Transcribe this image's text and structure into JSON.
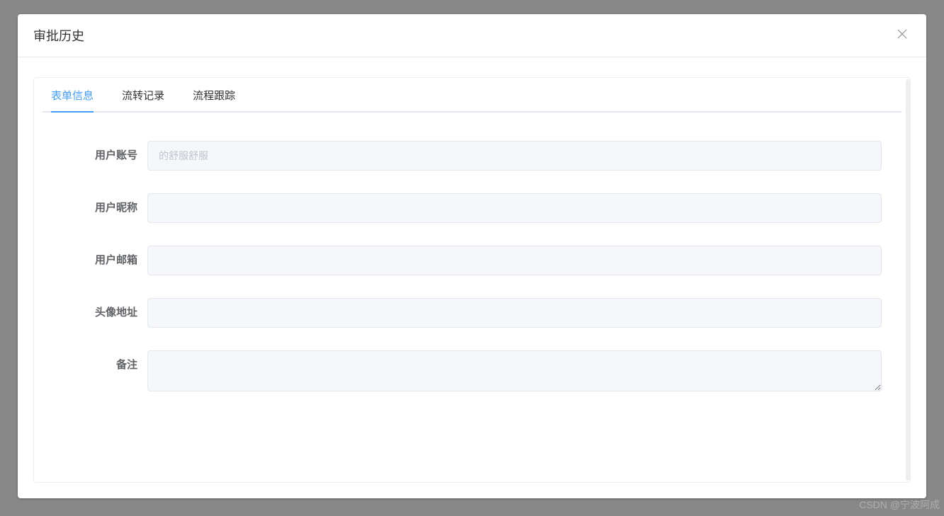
{
  "modal": {
    "title": "审批历史"
  },
  "tabs": [
    {
      "label": "表单信息",
      "active": true
    },
    {
      "label": "流转记录",
      "active": false
    },
    {
      "label": "流程跟踪",
      "active": false
    }
  ],
  "form": {
    "fields": {
      "user_account": {
        "label": "用户账号",
        "value": "",
        "placeholder": "的舒服舒服"
      },
      "user_nickname": {
        "label": "用户昵称",
        "value": "",
        "placeholder": ""
      },
      "user_email": {
        "label": "用户邮箱",
        "value": "",
        "placeholder": ""
      },
      "avatar_url": {
        "label": "头像地址",
        "value": "",
        "placeholder": ""
      },
      "remark": {
        "label": "备注",
        "value": "",
        "placeholder": ""
      }
    }
  },
  "watermark": "CSDN @宁波阿成"
}
